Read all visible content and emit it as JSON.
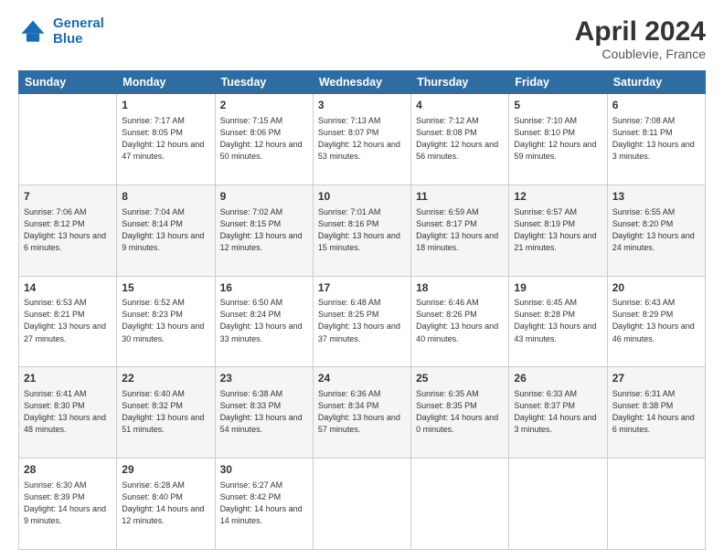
{
  "header": {
    "logo_line1": "General",
    "logo_line2": "Blue",
    "month": "April 2024",
    "location": "Coublevie, France"
  },
  "days_of_week": [
    "Sunday",
    "Monday",
    "Tuesday",
    "Wednesday",
    "Thursday",
    "Friday",
    "Saturday"
  ],
  "weeks": [
    [
      {
        "day": "",
        "sunrise": "",
        "sunset": "",
        "daylight": ""
      },
      {
        "day": "1",
        "sunrise": "Sunrise: 7:17 AM",
        "sunset": "Sunset: 8:05 PM",
        "daylight": "Daylight: 12 hours and 47 minutes."
      },
      {
        "day": "2",
        "sunrise": "Sunrise: 7:15 AM",
        "sunset": "Sunset: 8:06 PM",
        "daylight": "Daylight: 12 hours and 50 minutes."
      },
      {
        "day": "3",
        "sunrise": "Sunrise: 7:13 AM",
        "sunset": "Sunset: 8:07 PM",
        "daylight": "Daylight: 12 hours and 53 minutes."
      },
      {
        "day": "4",
        "sunrise": "Sunrise: 7:12 AM",
        "sunset": "Sunset: 8:08 PM",
        "daylight": "Daylight: 12 hours and 56 minutes."
      },
      {
        "day": "5",
        "sunrise": "Sunrise: 7:10 AM",
        "sunset": "Sunset: 8:10 PM",
        "daylight": "Daylight: 12 hours and 59 minutes."
      },
      {
        "day": "6",
        "sunrise": "Sunrise: 7:08 AM",
        "sunset": "Sunset: 8:11 PM",
        "daylight": "Daylight: 13 hours and 3 minutes."
      }
    ],
    [
      {
        "day": "7",
        "sunrise": "Sunrise: 7:06 AM",
        "sunset": "Sunset: 8:12 PM",
        "daylight": "Daylight: 13 hours and 6 minutes."
      },
      {
        "day": "8",
        "sunrise": "Sunrise: 7:04 AM",
        "sunset": "Sunset: 8:14 PM",
        "daylight": "Daylight: 13 hours and 9 minutes."
      },
      {
        "day": "9",
        "sunrise": "Sunrise: 7:02 AM",
        "sunset": "Sunset: 8:15 PM",
        "daylight": "Daylight: 13 hours and 12 minutes."
      },
      {
        "day": "10",
        "sunrise": "Sunrise: 7:01 AM",
        "sunset": "Sunset: 8:16 PM",
        "daylight": "Daylight: 13 hours and 15 minutes."
      },
      {
        "day": "11",
        "sunrise": "Sunrise: 6:59 AM",
        "sunset": "Sunset: 8:17 PM",
        "daylight": "Daylight: 13 hours and 18 minutes."
      },
      {
        "day": "12",
        "sunrise": "Sunrise: 6:57 AM",
        "sunset": "Sunset: 8:19 PM",
        "daylight": "Daylight: 13 hours and 21 minutes."
      },
      {
        "day": "13",
        "sunrise": "Sunrise: 6:55 AM",
        "sunset": "Sunset: 8:20 PM",
        "daylight": "Daylight: 13 hours and 24 minutes."
      }
    ],
    [
      {
        "day": "14",
        "sunrise": "Sunrise: 6:53 AM",
        "sunset": "Sunset: 8:21 PM",
        "daylight": "Daylight: 13 hours and 27 minutes."
      },
      {
        "day": "15",
        "sunrise": "Sunrise: 6:52 AM",
        "sunset": "Sunset: 8:23 PM",
        "daylight": "Daylight: 13 hours and 30 minutes."
      },
      {
        "day": "16",
        "sunrise": "Sunrise: 6:50 AM",
        "sunset": "Sunset: 8:24 PM",
        "daylight": "Daylight: 13 hours and 33 minutes."
      },
      {
        "day": "17",
        "sunrise": "Sunrise: 6:48 AM",
        "sunset": "Sunset: 8:25 PM",
        "daylight": "Daylight: 13 hours and 37 minutes."
      },
      {
        "day": "18",
        "sunrise": "Sunrise: 6:46 AM",
        "sunset": "Sunset: 8:26 PM",
        "daylight": "Daylight: 13 hours and 40 minutes."
      },
      {
        "day": "19",
        "sunrise": "Sunrise: 6:45 AM",
        "sunset": "Sunset: 8:28 PM",
        "daylight": "Daylight: 13 hours and 43 minutes."
      },
      {
        "day": "20",
        "sunrise": "Sunrise: 6:43 AM",
        "sunset": "Sunset: 8:29 PM",
        "daylight": "Daylight: 13 hours and 46 minutes."
      }
    ],
    [
      {
        "day": "21",
        "sunrise": "Sunrise: 6:41 AM",
        "sunset": "Sunset: 8:30 PM",
        "daylight": "Daylight: 13 hours and 48 minutes."
      },
      {
        "day": "22",
        "sunrise": "Sunrise: 6:40 AM",
        "sunset": "Sunset: 8:32 PM",
        "daylight": "Daylight: 13 hours and 51 minutes."
      },
      {
        "day": "23",
        "sunrise": "Sunrise: 6:38 AM",
        "sunset": "Sunset: 8:33 PM",
        "daylight": "Daylight: 13 hours and 54 minutes."
      },
      {
        "day": "24",
        "sunrise": "Sunrise: 6:36 AM",
        "sunset": "Sunset: 8:34 PM",
        "daylight": "Daylight: 13 hours and 57 minutes."
      },
      {
        "day": "25",
        "sunrise": "Sunrise: 6:35 AM",
        "sunset": "Sunset: 8:35 PM",
        "daylight": "Daylight: 14 hours and 0 minutes."
      },
      {
        "day": "26",
        "sunrise": "Sunrise: 6:33 AM",
        "sunset": "Sunset: 8:37 PM",
        "daylight": "Daylight: 14 hours and 3 minutes."
      },
      {
        "day": "27",
        "sunrise": "Sunrise: 6:31 AM",
        "sunset": "Sunset: 8:38 PM",
        "daylight": "Daylight: 14 hours and 6 minutes."
      }
    ],
    [
      {
        "day": "28",
        "sunrise": "Sunrise: 6:30 AM",
        "sunset": "Sunset: 8:39 PM",
        "daylight": "Daylight: 14 hours and 9 minutes."
      },
      {
        "day": "29",
        "sunrise": "Sunrise: 6:28 AM",
        "sunset": "Sunset: 8:40 PM",
        "daylight": "Daylight: 14 hours and 12 minutes."
      },
      {
        "day": "30",
        "sunrise": "Sunrise: 6:27 AM",
        "sunset": "Sunset: 8:42 PM",
        "daylight": "Daylight: 14 hours and 14 minutes."
      },
      {
        "day": "",
        "sunrise": "",
        "sunset": "",
        "daylight": ""
      },
      {
        "day": "",
        "sunrise": "",
        "sunset": "",
        "daylight": ""
      },
      {
        "day": "",
        "sunrise": "",
        "sunset": "",
        "daylight": ""
      },
      {
        "day": "",
        "sunrise": "",
        "sunset": "",
        "daylight": ""
      }
    ]
  ]
}
